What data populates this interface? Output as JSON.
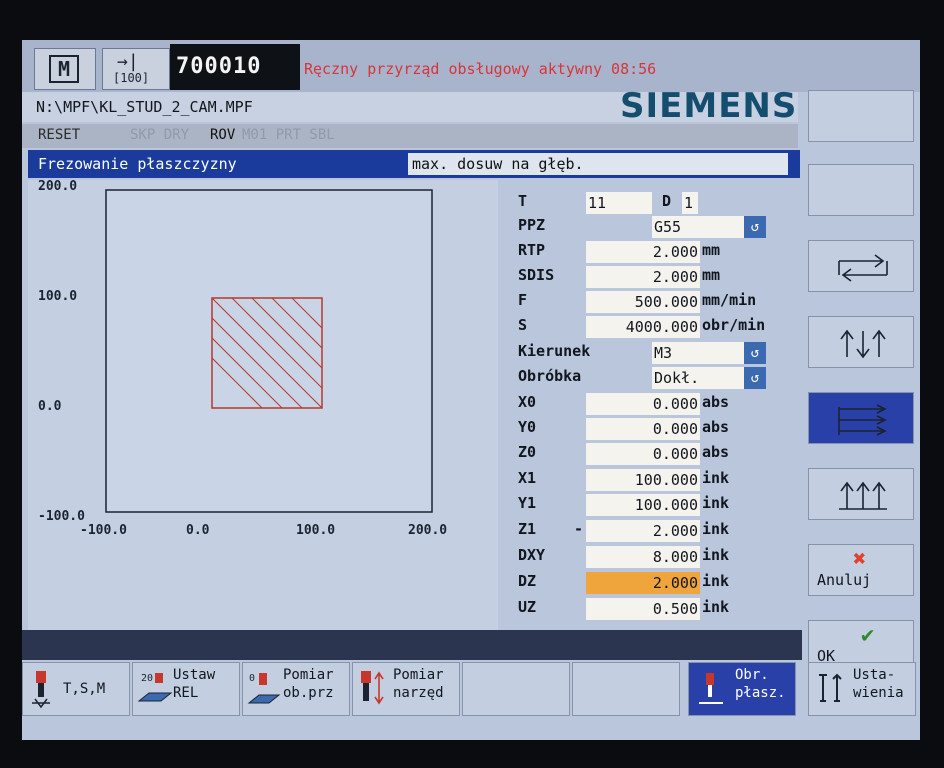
{
  "header": {
    "mode": "M",
    "channel_arrow": "→|",
    "channel_value": "[100]",
    "program_number": "700010",
    "alarm": "Ręczny przyrząd obsługowy aktywny 08:56",
    "path": "N:\\MPF\\KL_STUD_2_CAM.MPF",
    "logo": "SIEMENS",
    "colors": {
      "alarm": "#d8353a",
      "title_bar": "#1b3b9c",
      "focus": "#f0a43c",
      "logo": "#154d6e"
    }
  },
  "status": {
    "reset": "RESET",
    "flags_a": "SKP DRY",
    "rov": "ROV",
    "flags_b": "M01 PRT SBL"
  },
  "cycle": {
    "title": "Frezowanie płaszczyzny",
    "hint": "max. dosuw na głęb."
  },
  "graphic": {
    "y_labels": [
      "200.0",
      "100.0",
      "0.0",
      "-100.0"
    ],
    "x_labels": [
      "-100.0",
      "0.0",
      "100.0",
      "200.0"
    ]
  },
  "params": {
    "T": {
      "label": "T",
      "value": "11"
    },
    "D": {
      "label": "D",
      "value": "1"
    },
    "PPZ": {
      "label": "PPZ",
      "value": "G55"
    },
    "RTP": {
      "label": "RTP",
      "value": "2.000",
      "unit": "mm"
    },
    "SDIS": {
      "label": "SDIS",
      "value": "2.000",
      "unit": "mm"
    },
    "F": {
      "label": "F",
      "value": "500.000",
      "unit": "mm/min"
    },
    "S": {
      "label": "S",
      "value": "4000.000",
      "unit": "obr/min"
    },
    "Kierunek": {
      "label": "Kierunek",
      "value": "M3"
    },
    "Obrobka": {
      "label": "Obróbka",
      "value": "Dokł."
    },
    "X0": {
      "label": "X0",
      "value": "0.000",
      "unit": "abs"
    },
    "Y0": {
      "label": "Y0",
      "value": "0.000",
      "unit": "abs"
    },
    "Z0": {
      "label": "Z0",
      "value": "0.000",
      "unit": "abs"
    },
    "X1": {
      "label": "X1",
      "value": "100.000",
      "unit": "ink"
    },
    "Y1": {
      "label": "Y1",
      "value": "100.000",
      "unit": "ink"
    },
    "Z1": {
      "label": "Z1",
      "sign": "-",
      "value": "2.000",
      "unit": "ink"
    },
    "DXY": {
      "label": "DXY",
      "value": "8.000",
      "unit": "ink"
    },
    "DZ": {
      "label": "DZ",
      "value": "2.000",
      "unit": "ink"
    },
    "UZ": {
      "label": "UZ",
      "value": "0.500",
      "unit": "ink"
    }
  },
  "softkeys_right": {
    "cancel": "Anuluj",
    "ok": "OK"
  },
  "softkeys_bottom": {
    "tsm": "T,S,M",
    "ustaw_1": "Ustaw",
    "ustaw_2": "REL",
    "pomiar_ob_1": "Pomiar",
    "pomiar_ob_2": "ob.prz",
    "pomiar_narz_1": "Pomiar",
    "pomiar_narz_2": "narzęd",
    "obr_1": "Obr.",
    "obr_2": "płasz.",
    "usta_1": "Usta-",
    "usta_2": "wienia"
  }
}
